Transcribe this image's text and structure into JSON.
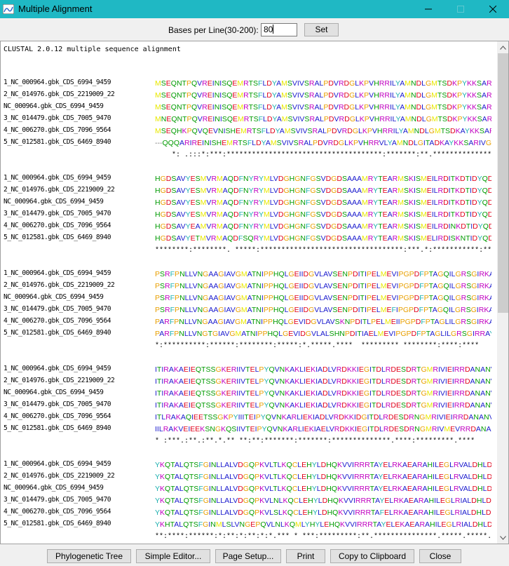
{
  "window": {
    "title": "Multiple Alignment"
  },
  "toolbar": {
    "bases_label": "Bases per Line(30-200):",
    "bases_value": "80",
    "set_label": "Set"
  },
  "alignment": {
    "header": "CLUSTAL 2.0.12 multiple sequence alignment",
    "blocks": [
      {
        "rows": [
          {
            "name": "1_NC_000964.gbk_CDS_6994_9459",
            "seq": "MSEQNTPQVREINISQEMRTSFLDYAMSVIVSRALPDVRDGLKPVHRRILYAMNDLGMTSDKPYKKSARIVGEVIGKYHP"
          },
          {
            "name": "2_NC_014976.gbk_CDS_2219009_22",
            "seq": "MSEQNTPQVREINISQEMRTSFLDYAMSVIVSRALPDVRDGLKPVHRRILYAMNDLGMTSDKPYKKSARIVGEVIGKYHP"
          },
          {
            "name": "NC_000964.gbk_CDS_6994_9459",
            "seq": "MSEQNTPQVREINISQEMRTSFLDYAMSVIVSRALPDVRDGLKPVHRRILYAMNDLGMTSDKPYKKSARIVGEVIGKYHP"
          },
          {
            "name": "3_NC_014479.gbk_CDS_7005_9470",
            "seq": "MNEQNTPQVREINISQEMRTSFLDYAMSVIVSRALPDVRDGLKPVHRRILYAMNDLGMTSDKPYKKSARIVGEVIGKYHP"
          },
          {
            "name": "4_NC_006270.gbk_CDS_7096_9564",
            "seq": "MSEQHKPQVQEVNISHEMRTSFLDYAMSVIVSRALPDVRDGLKPVHRRILYAMNDLGMTSDKAYKKSARIVGEVIGKYHP"
          },
          {
            "name": "5_NC_012581.gbk_CDS_6469_8940",
            "seq": "---QQQARIREINISHEMRTSFLDYAMSVIVSRALPDVRDGLKPVHRRVLYAMNDLGITADKAYKKSARIVGEVIGKYHP"
          }
        ],
        "consensus": "    *: .:::*:***:*************************************:*******:**.*****************"
      },
      {
        "rows": [
          {
            "name": "1_NC_000964.gbk_CDS_6994_9459",
            "seq": "HGDSAVYESMVRMAQDFNYRYMLVDGHGNFGSVDGDSAAAMRYTEARMSKISMEILRDITKDTIDYQDNYDGSEREPVVM"
          },
          {
            "name": "2_NC_014976.gbk_CDS_2219009_22",
            "seq": "HGDSAVYESMVRMAQDFNYRYMLVDGHGNFGSVDGDSAAAMRYTEARMSKISMEILRDITKDTIDYQDNYDGSEREPVVM"
          },
          {
            "name": "NC_000964.gbk_CDS_6994_9459",
            "seq": "HGDSAVYESMVRMAQDFNYRYMLVDGHGNFGSVDGDSAAAMRYTEARMSKISMEILRDITKDTIDYQDNYDGSEREPVVM"
          },
          {
            "name": "3_NC_014479.gbk_CDS_7005_9470",
            "seq": "HGDSAVYESMVRMAQDFNYRYMLVDGHGNFGSVDGDSAAAMRYTEARMSKISMEILRDITKDTIDYQDNYDGSEREPVVM"
          },
          {
            "name": "4_NC_006270.gbk_CDS_7096_9564",
            "seq": "HGDSAVYEAMVRMAQDFNYRYMLVDGHGNFGSVDGDSAAAMRYTEARMSKISMEILRDINKDTIDYQDNYDGSEKEPVVM"
          },
          {
            "name": "5_NC_012581.gbk_CDS_6469_8940",
            "seq": "HGDSAVYETMVRMAQDFSQRYMLVDGHGNFGSVDGDSAAAMRYTEARMSKISMELIRDISKNTIDYQDNYDGSEREPIVL"
          }
        ],
        "consensus": "********:********. *****:**********************************:***.*:***********:**:*:"
      },
      {
        "rows": [
          {
            "name": "1_NC_000964.gbk_CDS_6994_9459",
            "seq": "PSRFPNLLVNGAAGIAVGMATNIPPHQLGEIIDGVLAVSENPDITIPELMEVIPGPDFPTAGQILGRSGIRKAYESGRGS"
          },
          {
            "name": "2_NC_014976.gbk_CDS_2219009_22",
            "seq": "PSRFPNLLVNGAAGIAVGMATNIPPHQLGEIIDGVLAVSENPDITIPELMEVIPGPDFPTAGQILGRSGIRKAYESGRGS"
          },
          {
            "name": "NC_000964.gbk_CDS_6994_9459",
            "seq": "PSRFPNLLVNGAAGIAVGMATNIPPHQLGEIIDGVLAVSENPDITIPELMEVIPGPDFPTAGQILGRSGIRKAYESGRGS"
          },
          {
            "name": "3_NC_014479.gbk_CDS_7005_9470",
            "seq": "PSRFPNLLVNGAAGIAVGMATNIPPHQLGEIIDGVLAVSENPDITIPELMEFIPGPDFPTAGQILGRSGIRKAYESGRGS"
          },
          {
            "name": "4_NC_006270.gbk_CDS_7096_9564",
            "seq": "PARFPNLLVNGAAGIAVGMATNIPPHQLGEVIDGVLAVSKNPDITLPELMEIIPGPDFPTAGLILGRSGIRKAYETGRGS"
          },
          {
            "name": "5_NC_012581.gbk_CDS_6469_8940",
            "seq": "PARFPNLLVNGTGIAVGMATNIPPHQLGEVIDGVLALSHNPDITIAELMEVIPGPDFPTAGLILGRSGIRRAYETGRGS"
          }
        ],
        "consensus": "*:**********:******:********:*****:*.*****.****  ********* ********:****:****"
      },
      {
        "rows": [
          {
            "name": "1_NC_000964.gbk_CDS_6994_9459",
            "seq": "ITIRAKAEIEQTSSGKERIIVTELPYQVNKAKLIEKIADLVRDKKIEGITDLRDESDRTGMRIVIEIRRDANANVILNNL"
          },
          {
            "name": "2_NC_014976.gbk_CDS_2219009_22",
            "seq": "ITIRAKAEIEQTSSGKERIIVTELPYQVNKAKLIEKIADLVRDKKIEGITDLRDESDRTGMRIVIEIRRDANANVILNNL"
          },
          {
            "name": "NC_000964.gbk_CDS_6994_9459",
            "seq": "ITIRAKAEIEQTSSGKERIIVTELPYQVNKAKLIEKIADLVRDKKIEGITDLRDESDRTGMRIVIEIRRDANANVILNNL"
          },
          {
            "name": "3_NC_014479.gbk_CDS_7005_9470",
            "seq": "ITIRAKAEIEQTSSGKERIIVTELPYQVNKAKLIEKIADLVRDKKIEGITDLRDESDRTGMRIVIEIRRDANANVILNNL"
          },
          {
            "name": "4_NC_006270.gbk_CDS_7096_9564",
            "seq": "ITLRAKAQIEETSSGKPYIIITEIPYQVNKARLIEKIADLVRDKKIDGITDLRDESDRNGMRIVIEIRRDANANVLLNNL"
          },
          {
            "name": "5_NC_012581.gbk_CDS_6469_8940",
            "seq": "IILRAKVEIEEKSNGKQSIIVTEIPYQVNKARLIEKIAELVRDKKIEGITDLRDESDRNGMRIVMEVRRDANANVILNNL"
          }
        ],
        "consensus": "* :***.:**.:**.*.** **:**:*******:*******:**************.****:*********.****"
      },
      {
        "rows": [
          {
            "name": "1_NC_000964.gbk_CDS_6994_9459",
            "seq": "YKQTALQTSFGINLLALVDGQPKVLTLKQCLEHYLDHQKVVIRRRTAYELRKAEARAHILEGLRVALDHLDAVISLIRNS"
          },
          {
            "name": "2_NC_014976.gbk_CDS_2219009_22",
            "seq": "YKQTALQTSFGINLLALVDGQPKVLTLKQCLEHYLDHQKVVIRRRTAYELRKAEARAHILEGLRVALDHLDAVISLIRNS"
          },
          {
            "name": "NC_000964.gbk_CDS_6994_9459",
            "seq": "YKQTALQTSFGINLLALVDGQPKVLTLKQCLEHYLDHQKVVIRRRTAYELRKAEARAHILEGLRVALDHLDAVISLIRNS"
          },
          {
            "name": "3_NC_014479.gbk_CDS_7005_9470",
            "seq": "YKQTALQTSFGINLLALVDGQPKVLNLKQCLEHYLDHQKVVIRRRTAYELRKAEARAHILEGLRIALDHLDAVISLIRNS"
          },
          {
            "name": "4_NC_006270.gbk_CDS_7096_9564",
            "seq": "YKQTALQTSFGINLLALVDGQPKVLSLKQCLEHYLDHQKVVIRRRTAFELRKAEARAHILEGLRIALDHLDEVISLIRNS"
          },
          {
            "name": "5_NC_012581.gbk_CDS_6469_8940",
            "seq": "YKHTALQTSFGINMLSLVNGEPQVLNLKQMLYHYLEHQKVVIRRRTAYELEKAEARAHILEGLRIALDHLDEVITLIRSS"
          }
        ],
        "consensus": "**:****:******:*:**:*:**:*:*.*** * ***:*********:**.***************.*****.*****.*"
      }
    ]
  },
  "buttons": {
    "tree": "Phylogenetic Tree",
    "editor": "Simple Editor...",
    "page_setup": "Page Setup...",
    "print": "Print",
    "copy": "Copy to Clipboard",
    "close": "Close"
  },
  "colors": {
    "titlebar": "#1fb8c4",
    "hydrophobic": "#1a1acd",
    "acidic": "#e0001a",
    "basic": "#c000c0",
    "polar": "#009a00",
    "gly_pro": "#e89f00",
    "aromatic": "#1fb0b0",
    "met": "#e8e800"
  }
}
